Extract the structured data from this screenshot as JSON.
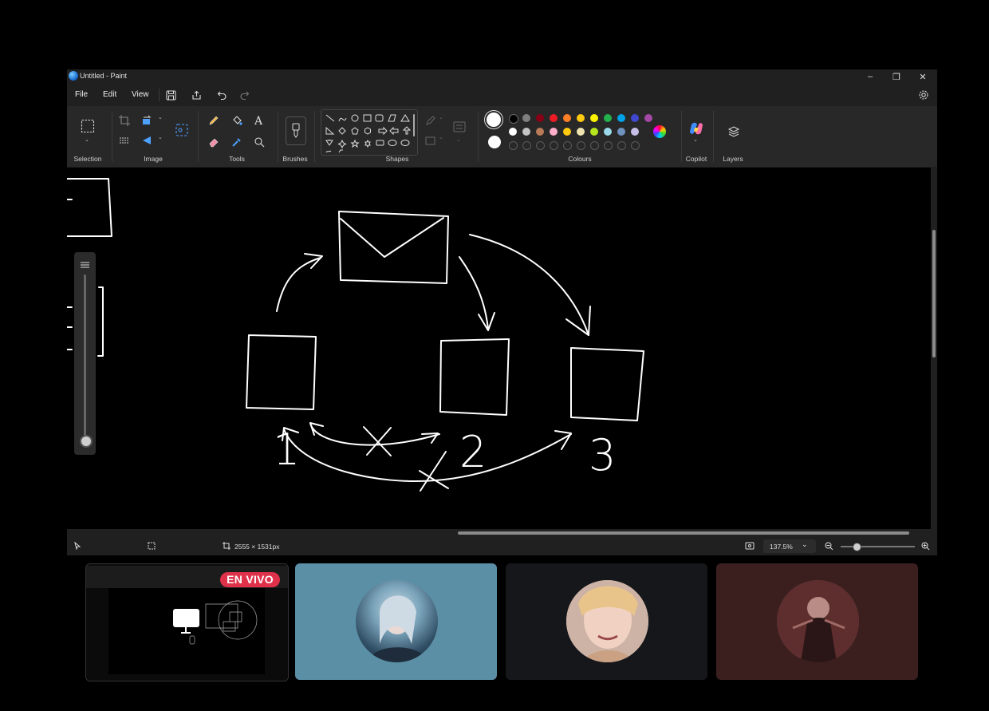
{
  "window": {
    "title": "Untitled - Paint",
    "controls": {
      "minimize": "–",
      "restore": "❐",
      "close": "✕"
    }
  },
  "menu": {
    "file": "File",
    "edit": "Edit",
    "view": "View"
  },
  "ribbon": {
    "groups": {
      "selection": "Selection",
      "image": "Image",
      "tools": "Tools",
      "brushes": "Brushes",
      "shapes": "Shapes",
      "colours": "Colours",
      "copilot": "Copilot",
      "layers": "Layers"
    },
    "colours": {
      "row1": [
        "#000000",
        "#7f7f7f",
        "#880015",
        "#ed1c24",
        "#ff7f27",
        "#ffc90e",
        "#fff200",
        "#22b14c",
        "#00a2e8",
        "#3f48cc",
        "#a349a4"
      ],
      "row2": [
        "#ffffff",
        "#c3c3c3",
        "#b97a57",
        "#ffaec9",
        "#ffc90e",
        "#efe4b0",
        "#b5e61d",
        "#99d9ea",
        "#7092be",
        "#c8bfe7"
      ],
      "empty_slots": 10
    }
  },
  "canvas": {
    "box_labels": [
      "1",
      "2",
      "3"
    ]
  },
  "status": {
    "dimensions": "2555 × 1531px",
    "zoom": "137.5%"
  },
  "participants": {
    "live_badge": "EN VIVO",
    "tile_colors": [
      "#5b8fa6",
      "#16171b",
      "#3b1f1f"
    ]
  }
}
